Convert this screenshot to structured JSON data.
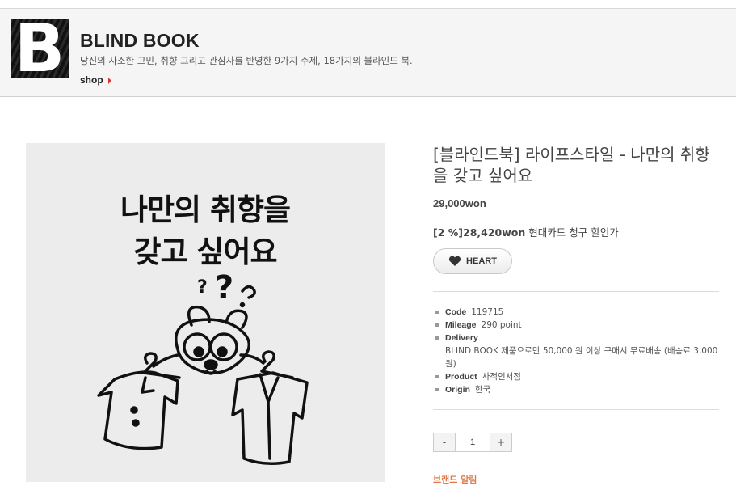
{
  "brand": {
    "logo_letter": "B",
    "name": "BLIND BOOK",
    "description": "당신의 사소한 고민, 취향 그리고 관심사를 반영한 9가지 주제, 18가지의 블라인드 북.",
    "shop_label": "shop",
    "accent_color": "#dd3333"
  },
  "image": {
    "line1": "나만의 취향을",
    "line2": "갖고 싶어요",
    "icon": "cartoon-character-with-clothes"
  },
  "product": {
    "title": "[블라인드북] 라이프스타일 - 나만의 취향을 갖고 싶어요",
    "price": "29,000won",
    "card_discount": "[2 %]28,420won",
    "card_discount_desc": "현대카드 청구 할인가",
    "heart_label": "HEART"
  },
  "info": {
    "code_label": "Code",
    "code_value": "119715",
    "mileage_label": "Mileage",
    "mileage_value": "290 point",
    "delivery_label": "Delivery",
    "delivery_value": "BLIND BOOK 제품으로만 50,000 원 이상 구매시 무료배송 (배송료 3,000 원)",
    "product_label": "Product",
    "product_value": "사적인서점",
    "origin_label": "Origin",
    "origin_value": "한국"
  },
  "quantity": {
    "minus": "-",
    "value": "1",
    "plus": "+"
  },
  "notice": "브랜드 알림"
}
